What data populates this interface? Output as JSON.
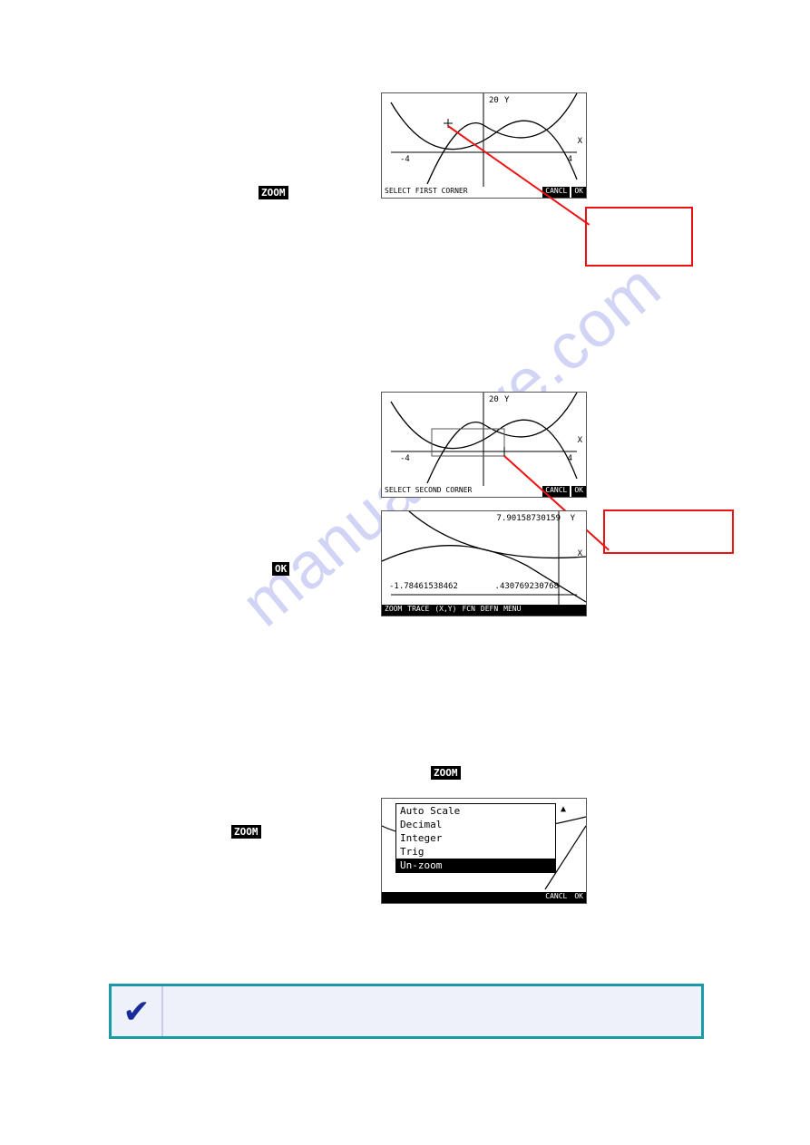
{
  "watermark": "manualshive.com",
  "tags": {
    "zoom": "ZOOM",
    "ok": "OK"
  },
  "screen1": {
    "ylabel": "20",
    "yaxis": "Y",
    "xaxis": "X",
    "xmin": "-4",
    "xmax": "4",
    "status": "SELECT FIRST CORNER",
    "btn_cancel": "CANCL",
    "btn_ok": "OK"
  },
  "screen2": {
    "ylabel": "20",
    "yaxis": "Y",
    "xaxis": "X",
    "xmin": "-4",
    "xmax": "4",
    "status": "SELECT SECOND CORNER",
    "btn_cancel": "CANCL",
    "btn_ok": "OK"
  },
  "screen3": {
    "yval": "7.90158730159",
    "yaxis": "Y",
    "xaxis": "X",
    "xmin": "-1.78461538462",
    "xmax": ".430769230768",
    "btns": [
      "ZOOM",
      "TRACE",
      "(X,Y)",
      "FCN",
      "DEFN",
      "MENU"
    ]
  },
  "screen4": {
    "items": [
      "Auto Scale",
      "Decimal",
      "Integer",
      "Trig",
      "Un-zoom"
    ],
    "btn_cancel": "CANCL",
    "btn_ok": "OK"
  },
  "tip_icon": "✔"
}
